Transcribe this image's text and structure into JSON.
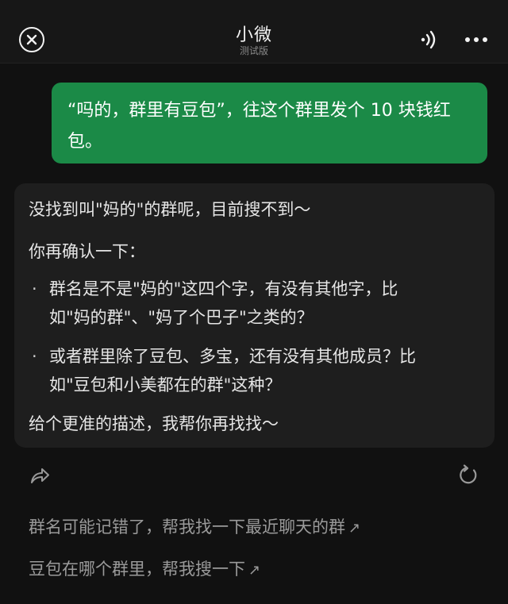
{
  "header": {
    "title": "小微",
    "subtitle": "测试版",
    "icons": {
      "close": "close-icon",
      "voice": "sound-wave-icon",
      "more": "more-dots-icon"
    }
  },
  "user_message": {
    "line1": "“吗的，群里有豆包”，往这个群里发个 10 块钱红",
    "line2": "包。"
  },
  "ai_reply": {
    "line1": "没找到叫\"妈的\"的群呢，目前搜不到～",
    "line2": "你再确认一下：",
    "bullets": [
      {
        "line1": "群名是不是\"妈的\"这四个字，有没有其他字，比",
        "line2": "如\"妈的群\"、\"妈了个巴子\"之类的？"
      },
      {
        "line1": "或者群里除了豆包、多宝，还有没有其他成员？比",
        "line2": "如\"豆包和小美都在的群\"这种？"
      }
    ],
    "closing": "给个更准的描述，我帮你再找找～",
    "bullet_char": "·"
  },
  "actions": {
    "share_icon": "share-icon",
    "refresh_icon": "refresh-icon"
  },
  "suggestions": [
    {
      "text": "群名可能记错了，帮我找一下最近聊天的群",
      "arrow": "↗"
    },
    {
      "text": "豆包在哪个群里，帮我搜一下",
      "arrow": "↗"
    }
  ],
  "colors": {
    "background": "#111111",
    "user_bubble": "#1b8a47",
    "ai_card": "#1e1e1e",
    "suggestion_text": "#9a9a9a"
  }
}
